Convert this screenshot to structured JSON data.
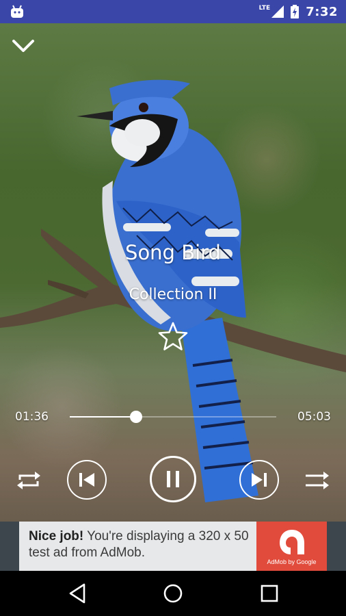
{
  "status_bar": {
    "network": "LTE",
    "time": "7:32"
  },
  "player": {
    "song_title": "Song Bird",
    "album": "Collection II",
    "current_time": "01:36",
    "total_time": "05:03",
    "progress": 0.32,
    "favorite": false,
    "is_playing": true
  },
  "ad": {
    "headline": "Nice job!",
    "body": " You're displaying a 320 x 50 test ad from AdMob.",
    "brand": "AdMob by Google",
    "accent_color": "#e14b3b"
  },
  "icons": {
    "collapse": "chevron-down-icon",
    "favorite": "star-outline-icon",
    "repeat": "repeat-icon",
    "previous": "skip-previous-icon",
    "pause": "pause-icon",
    "next": "skip-next-icon",
    "shuffle": "shuffle-icon"
  },
  "colors": {
    "status_bar": "#3a47a8",
    "ad_background": "#3d464c"
  }
}
